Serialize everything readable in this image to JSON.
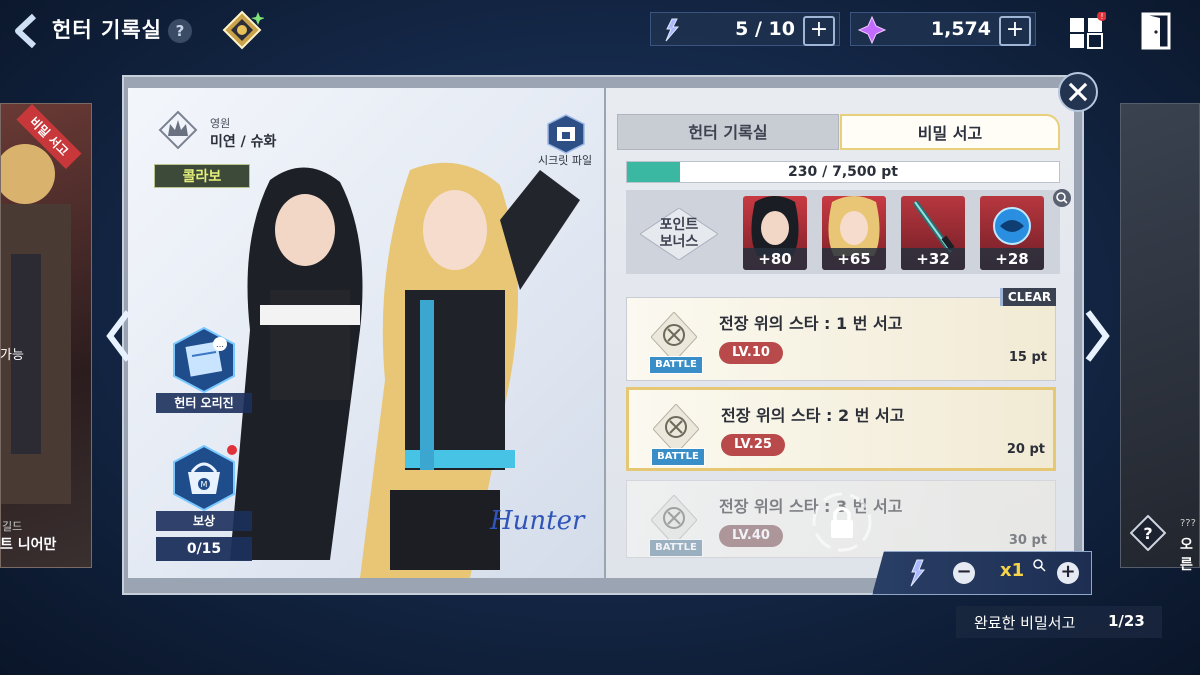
{
  "header": {
    "title": "헌터 기록실",
    "help": "?",
    "stamina": {
      "value": "5 / 10",
      "plus": "+"
    },
    "gems": {
      "value": "1,574",
      "plus": "+"
    }
  },
  "left_card": {
    "badge": "비밀 서고",
    "status": "가능",
    "guild": "길드",
    "name": "트 니어만"
  },
  "right_card": {
    "badge": "?",
    "unknown": "???",
    "name": "오른"
  },
  "hunter": {
    "rank_label": "영원",
    "names": "미연 / 슈화",
    "collab": "콜라보",
    "secret_file": "시크릿 파일",
    "origin_label": "헌터 오리진",
    "reward_label": "보상",
    "reward_count": "0/15",
    "signature": "Hunter"
  },
  "tabs": [
    {
      "label": "헌터 기록실"
    },
    {
      "label": "비밀 서고"
    }
  ],
  "progress": {
    "text": "230 / 7,500 pt",
    "fraction": 0.0307
  },
  "bonus": {
    "label": "포인트 보너스",
    "label_line1": "포인트",
    "label_line2": "보너스",
    "items": [
      {
        "value": "+80"
      },
      {
        "value": "+65"
      },
      {
        "value": "+32"
      },
      {
        "value": "+28"
      }
    ]
  },
  "missions": [
    {
      "title": "전장 위의 스타 : 1 번 서고",
      "level": "LV.10",
      "points": "15 pt",
      "tag": "CLEAR",
      "badge": "BATTLE"
    },
    {
      "title": "전장 위의 스타 : 2 번 서고",
      "level": "LV.25",
      "points": "20 pt",
      "badge": "BATTLE"
    },
    {
      "title": "전장 위의 스타 : 3 번 서고",
      "level": "LV.40",
      "points": "30 pt",
      "badge": "BATTLE"
    }
  ],
  "quantity": {
    "value": "x1",
    "minus": "−",
    "plus": "+"
  },
  "footer": {
    "label": "완료한 비밀서고",
    "count": "1/23"
  },
  "colors": {
    "accent_teal": "#3ab8a2",
    "level_red": "#b94a4c",
    "selected_gold": "#e6c874",
    "qty_yellow": "#f5d44a"
  }
}
